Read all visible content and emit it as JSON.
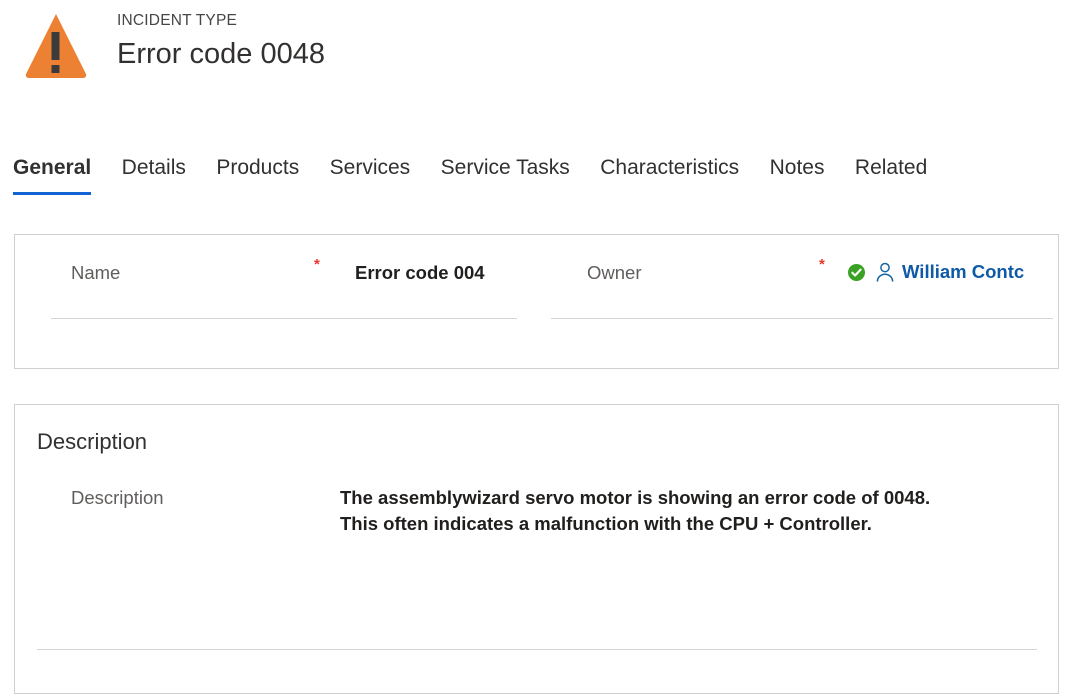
{
  "header": {
    "icon": "warning-triangle-icon",
    "icon_color": "#ed8133",
    "eyebrow": "INCIDENT TYPE",
    "title": "Error code 0048"
  },
  "tabs": [
    {
      "label": "General",
      "active": true
    },
    {
      "label": "Details",
      "active": false
    },
    {
      "label": "Products",
      "active": false
    },
    {
      "label": "Services",
      "active": false
    },
    {
      "label": "Service Tasks",
      "active": false
    },
    {
      "label": "Characteristics",
      "active": false
    },
    {
      "label": "Notes",
      "active": false
    },
    {
      "label": "Related",
      "active": false
    }
  ],
  "accent_color": "#1264d4",
  "general_card": {
    "name_field": {
      "label": "Name",
      "required_marker": "*",
      "value": "Error code 004"
    },
    "owner_field": {
      "label": "Owner",
      "required_marker": "*",
      "status_icon": "green-check-badge-icon",
      "status_color": "#39a124",
      "person_icon": "person-icon",
      "value": "William Contc",
      "value_color": "#0f5aa6"
    }
  },
  "description_card": {
    "section_title": "Description",
    "field_label": "Description",
    "value_line_1": "The assemblywizard servo motor is showing an error code of 0048.",
    "value_line_2": "This often indicates a malfunction with the CPU + Controller."
  }
}
